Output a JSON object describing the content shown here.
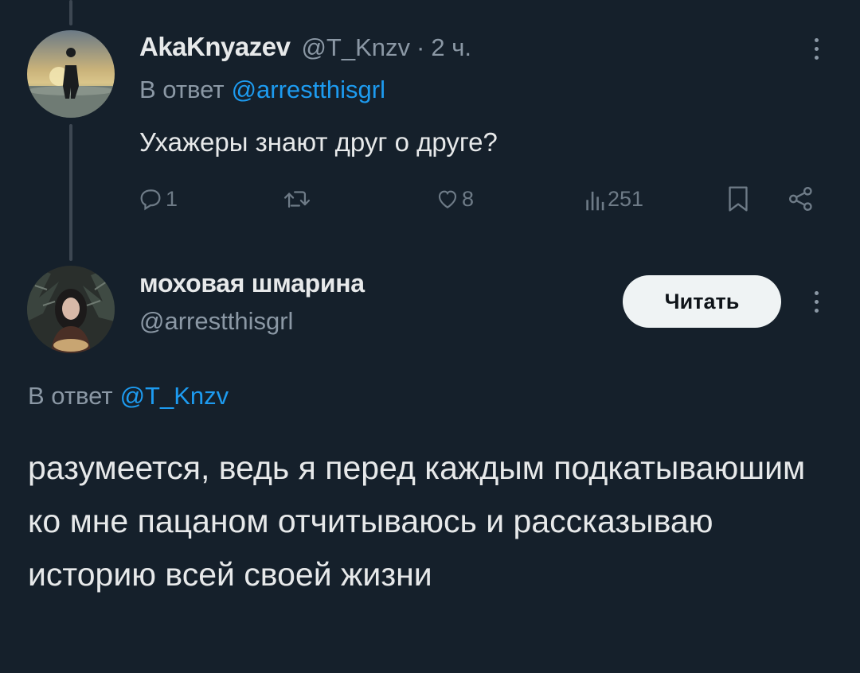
{
  "tweet1": {
    "name": "AkaKnyazev",
    "handle": "@T_Knzv",
    "dot": "·",
    "time": "2 ч.",
    "reply_label": "В ответ",
    "reply_mention": "@arrestthisgrl",
    "text": "Ухажеры знают друг о друге?",
    "stats": {
      "replies": "1",
      "likes": "8",
      "views": "251"
    },
    "icons": [
      "reply-icon",
      "retweet-icon",
      "like-icon",
      "views-icon",
      "bookmark-icon",
      "share-icon",
      "more-icon"
    ]
  },
  "tweet2": {
    "name": "моховая шмарина",
    "handle": "@arrestthisgrl",
    "follow_label": "Читать",
    "reply_label": "В ответ",
    "reply_mention": "@T_Knzv",
    "text": "разумеется, ведь я перед каждым подкатываюшим ко мне пацаном отчитываюсь и рассказываю историю всей своей жизни"
  },
  "colors": {
    "background": "#15202b",
    "text": "#e7e9ea",
    "secondary": "#8b98a5",
    "accent": "#1d9bf0",
    "button_bg": "#eff3f4"
  }
}
